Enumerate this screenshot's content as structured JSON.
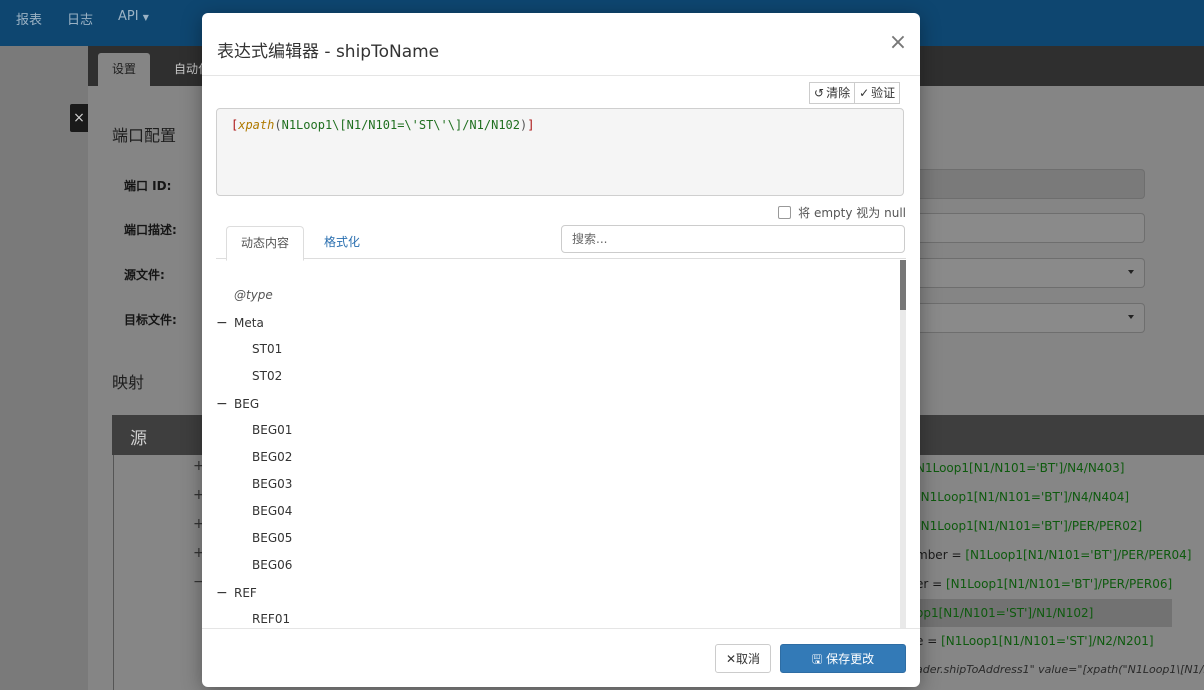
{
  "nav": {
    "items": [
      "报表",
      "日志",
      "API"
    ]
  },
  "tabs": {
    "settings": "设置",
    "other": "自动化"
  },
  "page": {
    "close_tab": "×",
    "section_port": "端口配置",
    "labels": [
      "端口 ID:",
      "端口描述:",
      "源文件:",
      "目标文件:"
    ],
    "section_map": "映射",
    "map_source": "源"
  },
  "map_lines": [
    {
      "pre": "",
      "green": "N1Loop1[N1/N101='BT']/N4/N403]"
    },
    {
      "pre": "",
      "green": "[N1Loop1[N1/N101='BT']/N4/N404]"
    },
    {
      "pre": "",
      "green": "[N1Loop1[N1/N101='BT']/PER/PER02]"
    },
    {
      "pre": "mber = ",
      "green": "[N1Loop1[N1/N101='BT']/PER/PER04]"
    },
    {
      "pre": "er = ",
      "green": "[N1Loop1[N1/N101='BT']/PER/PER06]"
    },
    {
      "pre": "",
      "green": "op1[N1/N101='ST']/N1/N102]"
    },
    {
      "pre": "e = ",
      "green": "[N1Loop1[N1/N101='ST']/N2/N201]"
    }
  ],
  "map_last": "ader.shipToAddress1\" value=\"[xpath(\"N1Loop1\\[N1/N",
  "modal": {
    "title": "表达式编辑器 - shipToName",
    "clear_label": "清除",
    "verify_label": "验证",
    "expr": {
      "open": "[",
      "fn": "xpath",
      "lparen": "(",
      "arg": "N1Loop1\\[N1/N101=\\'ST\\'\\]/N1/N102",
      "rparen": ")",
      "close": "]"
    },
    "empty_null_label": "将 empty 视为 null",
    "tab_dynamic": "动态内容",
    "tab_format": "格式化",
    "search_placeholder": "搜索...",
    "tree": [
      {
        "label": "@type",
        "level": 0,
        "toggle": ""
      },
      {
        "label": "Meta",
        "level": 0,
        "toggle": "−"
      },
      {
        "label": "ST01",
        "level": 1,
        "toggle": ""
      },
      {
        "label": "ST02",
        "level": 1,
        "toggle": ""
      },
      {
        "label": "BEG",
        "level": 0,
        "toggle": "−"
      },
      {
        "label": "BEG01",
        "level": 1,
        "toggle": ""
      },
      {
        "label": "BEG02",
        "level": 1,
        "toggle": ""
      },
      {
        "label": "BEG03",
        "level": 1,
        "toggle": ""
      },
      {
        "label": "BEG04",
        "level": 1,
        "toggle": ""
      },
      {
        "label": "BEG05",
        "level": 1,
        "toggle": ""
      },
      {
        "label": "BEG06",
        "level": 1,
        "toggle": ""
      },
      {
        "label": "REF",
        "level": 0,
        "toggle": "−"
      },
      {
        "label": "REF01",
        "level": 1,
        "toggle": ""
      }
    ],
    "cancel_label": "取消",
    "save_label": "保存更改"
  },
  "colors": {
    "primary": "#337ab7",
    "nav": "#0e4670"
  }
}
